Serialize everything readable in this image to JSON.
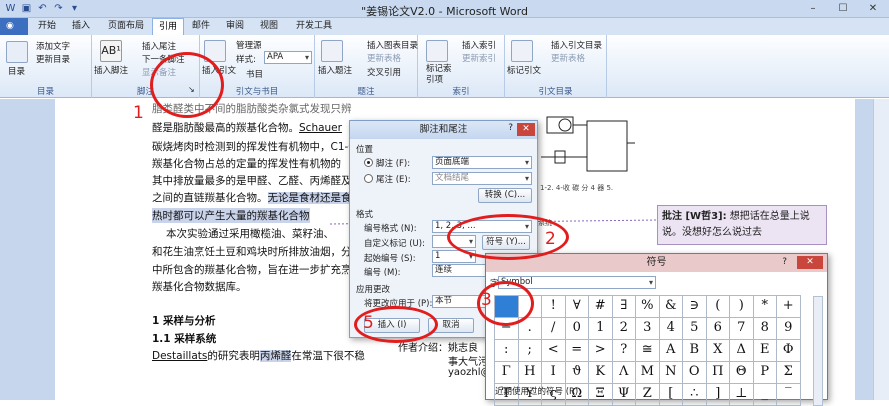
{
  "window": {
    "title": "\"姜锡论文V2.0 - Microsoft Word",
    "min": "–",
    "max": "☐",
    "close": "✕"
  },
  "tabs": [
    "开始",
    "插入",
    "页面布局",
    "引用",
    "邮件",
    "审阅",
    "视图",
    "开发工具"
  ],
  "ribbon": {
    "toc": {
      "add_text": "添加文字",
      "update": "更新目录",
      "big": "目录",
      "group": "目录"
    },
    "fn": {
      "insert_endnote": "插入尾注",
      "next_fn": "下一条脚注",
      "show_notes": "显示备注",
      "big": "插入脚注",
      "group": "脚注"
    },
    "cite": {
      "manage": "管理源",
      "style_label": "样式:",
      "style": "APA",
      "bib": "书目",
      "big": "插入引文",
      "group": "引文与书目"
    },
    "caption": {
      "insert_table": "插入图表目录",
      "update_table": "更新表格",
      "cross": "交叉引用",
      "big": "插入题注",
      "group": "题注"
    },
    "index": {
      "entry": "插入索引",
      "update": "更新索引",
      "big": "标记索引项",
      "group": "索引"
    },
    "auth": {
      "insert": "插入引文目录",
      "update": "更新表格",
      "big": "标记引文",
      "group": "引文目录"
    }
  },
  "doc": {
    "l1": "脂类醛类中不间的脂肪酸类杂氯式发现只辨",
    "l2a": "醛是脂肪酸最高的羰基化合物。",
    "l2b": "Schauer",
    "l3": "碳烧烤肉时检测到的挥发性有机物中，",
    "l3b": "C1-C",
    "l4": "羰基化合物占总的定量的挥发性有机物的",
    "l5": "其中排放量最多的是甲醛、乙醛、丙烯醛及",
    "l6a": "之间的直链羰基化合物。",
    "l6b": "无论是食材还是食",
    "l7": "热时都可以产生大量的羰基化合物",
    "l8": "本次实验通过采用橄榄油、菜籽油、",
    "l9": "和花生油烹饪土豆和鸡块时所排放油烟，分",
    "l10": "中所包含的羰基化合物，旨在进一步扩充烹",
    "l11": "羰基化合物数据库。",
    "h1": "1  采样与分析",
    "h2": "1.1   采样系统",
    "l12a": "Destaillats",
    "l12b": "的研究表明",
    "l12c": "丙烯醛",
    "l12d": "在常温下很不稳",
    "author": "作者介绍：姚志良",
    "author2": "事大气污",
    "email": "yaozhl@",
    "fig_caption": "1-2. 4-收 碳 分 4 器 5.",
    "fig_side": "系统"
  },
  "comment": {
    "label": "批注 [W哲3]:",
    "text": "想把话在总量上说说。没想好怎么说过去"
  },
  "fn_dialog": {
    "title": "脚注和尾注",
    "help": "?",
    "close": "✕",
    "pos": "位置",
    "footnote": "脚注 (F):",
    "footnote_val": "页面底端",
    "endnote": "尾注 (E):",
    "endnote_val": "文档结尾",
    "convert": "转换 (C)...",
    "format": "格式",
    "numfmt": "编号格式 (N):",
    "numfmt_val": "1, 2, 3, ...",
    "custom": "自定义标记 (U):",
    "symbol": "符号 (Y)...",
    "start": "起始编号 (S):",
    "start_val": "1",
    "numbering": "编号 (M):",
    "numbering_val": "连续",
    "apply": "应用更改",
    "apply_to": "将更改应用于 (P):",
    "apply_val": "本节",
    "insert": "插入 (I)",
    "cancel": "取消"
  },
  "sym_dialog": {
    "title": "符号",
    "font_label": "字体 (F):",
    "font": "Symbol",
    "grid": [
      [
        "",
        " ",
        "!",
        "∀",
        "#",
        "∃",
        "%",
        "&",
        "∋",
        "(",
        ")",
        "*",
        "+",
        ","
      ],
      [
        "−",
        ".",
        "/",
        "0",
        "1",
        "2",
        "3",
        "4",
        "5",
        "6",
        "7",
        "8",
        "9"
      ],
      [
        ":",
        ";",
        "<",
        "=",
        ">",
        "?",
        "≅",
        "Α",
        "Β",
        "Χ",
        "Δ",
        "Ε",
        "Φ"
      ],
      [
        "Γ",
        "Η",
        "Ι",
        "ϑ",
        "Κ",
        "Λ",
        "Μ",
        "Ν",
        "Ο",
        "Π",
        "Θ",
        "Ρ",
        "Σ"
      ],
      [
        "Τ",
        "Υ",
        "ς",
        "Ω",
        "Ξ",
        "Ψ",
        "Ζ",
        "[",
        "∴",
        "]",
        "⊥",
        "_",
        "‾"
      ]
    ],
    "recent": "近期使用过的符号 (R):"
  },
  "annotations": [
    "1",
    "2",
    "3",
    "5"
  ],
  "accent": "#e11d1d"
}
